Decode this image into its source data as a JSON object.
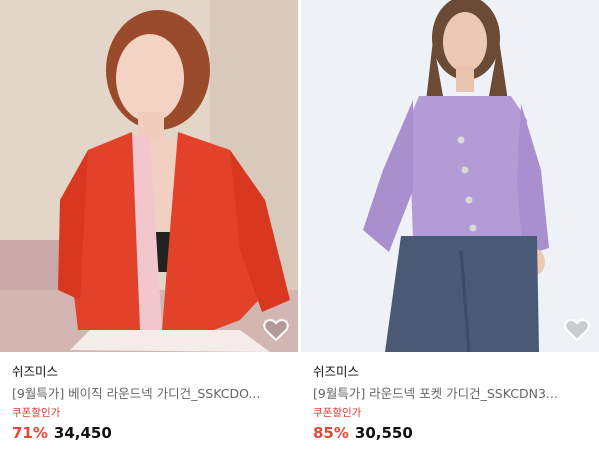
{
  "products": [
    {
      "brand": "쉬즈미스",
      "title": "[9월특가] 베이직 라운드넥 가디건_SSKCDO...",
      "coupon_label": "쿠폰할인가",
      "discount": "71%",
      "price": "34,450",
      "image_icon": "model-red-cardigan-image",
      "wish_icon": "heart-outline-icon"
    },
    {
      "brand": "쉬즈미스",
      "title": "[9월특가] 라운드넥 포켓 가디건_SSKCDN3...",
      "coupon_label": "쿠폰할인가",
      "discount": "85%",
      "price": "30,550",
      "image_icon": "model-lavender-cardigan-image",
      "wish_icon": "heart-outline-icon"
    }
  ],
  "colors": {
    "discount": "#e6453a",
    "coupon": "#e03a2f",
    "red_cardigan": "#e2412a",
    "lavender_cardigan": "#b39bd6"
  }
}
